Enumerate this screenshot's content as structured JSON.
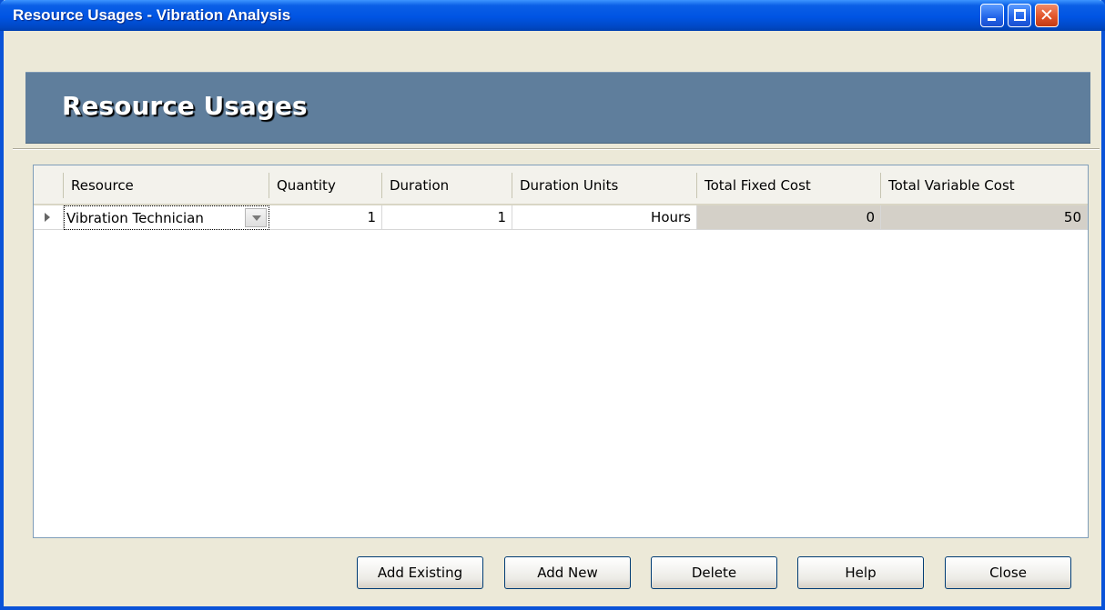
{
  "window": {
    "title": "Resource Usages - Vibration Analysis",
    "controls": {
      "minimize_icon": "minimize-icon",
      "maximize_icon": "maximize-icon",
      "close_icon": "close-icon",
      "close_glyph": "✕"
    }
  },
  "header": {
    "title": "Resource Usages"
  },
  "grid": {
    "columns": [
      "Resource",
      "Quantity",
      "Duration",
      "Duration Units",
      "Total Fixed Cost",
      "Total Variable Cost"
    ],
    "rows": [
      {
        "resource": "Vibration Technician",
        "quantity": "1",
        "duration": "1",
        "duration_units": "Hours",
        "total_fixed_cost": "0",
        "total_variable_cost": "50"
      }
    ]
  },
  "buttons": {
    "add_existing": "Add Existing",
    "add_new": "Add New",
    "delete": "Delete",
    "help": "Help",
    "close": "Close"
  },
  "colors": {
    "titlebar": "#0054e3",
    "header_band": "#5f7e9c",
    "window_bg": "#ece9d8",
    "readonly_cell": "#d4d0c8"
  }
}
